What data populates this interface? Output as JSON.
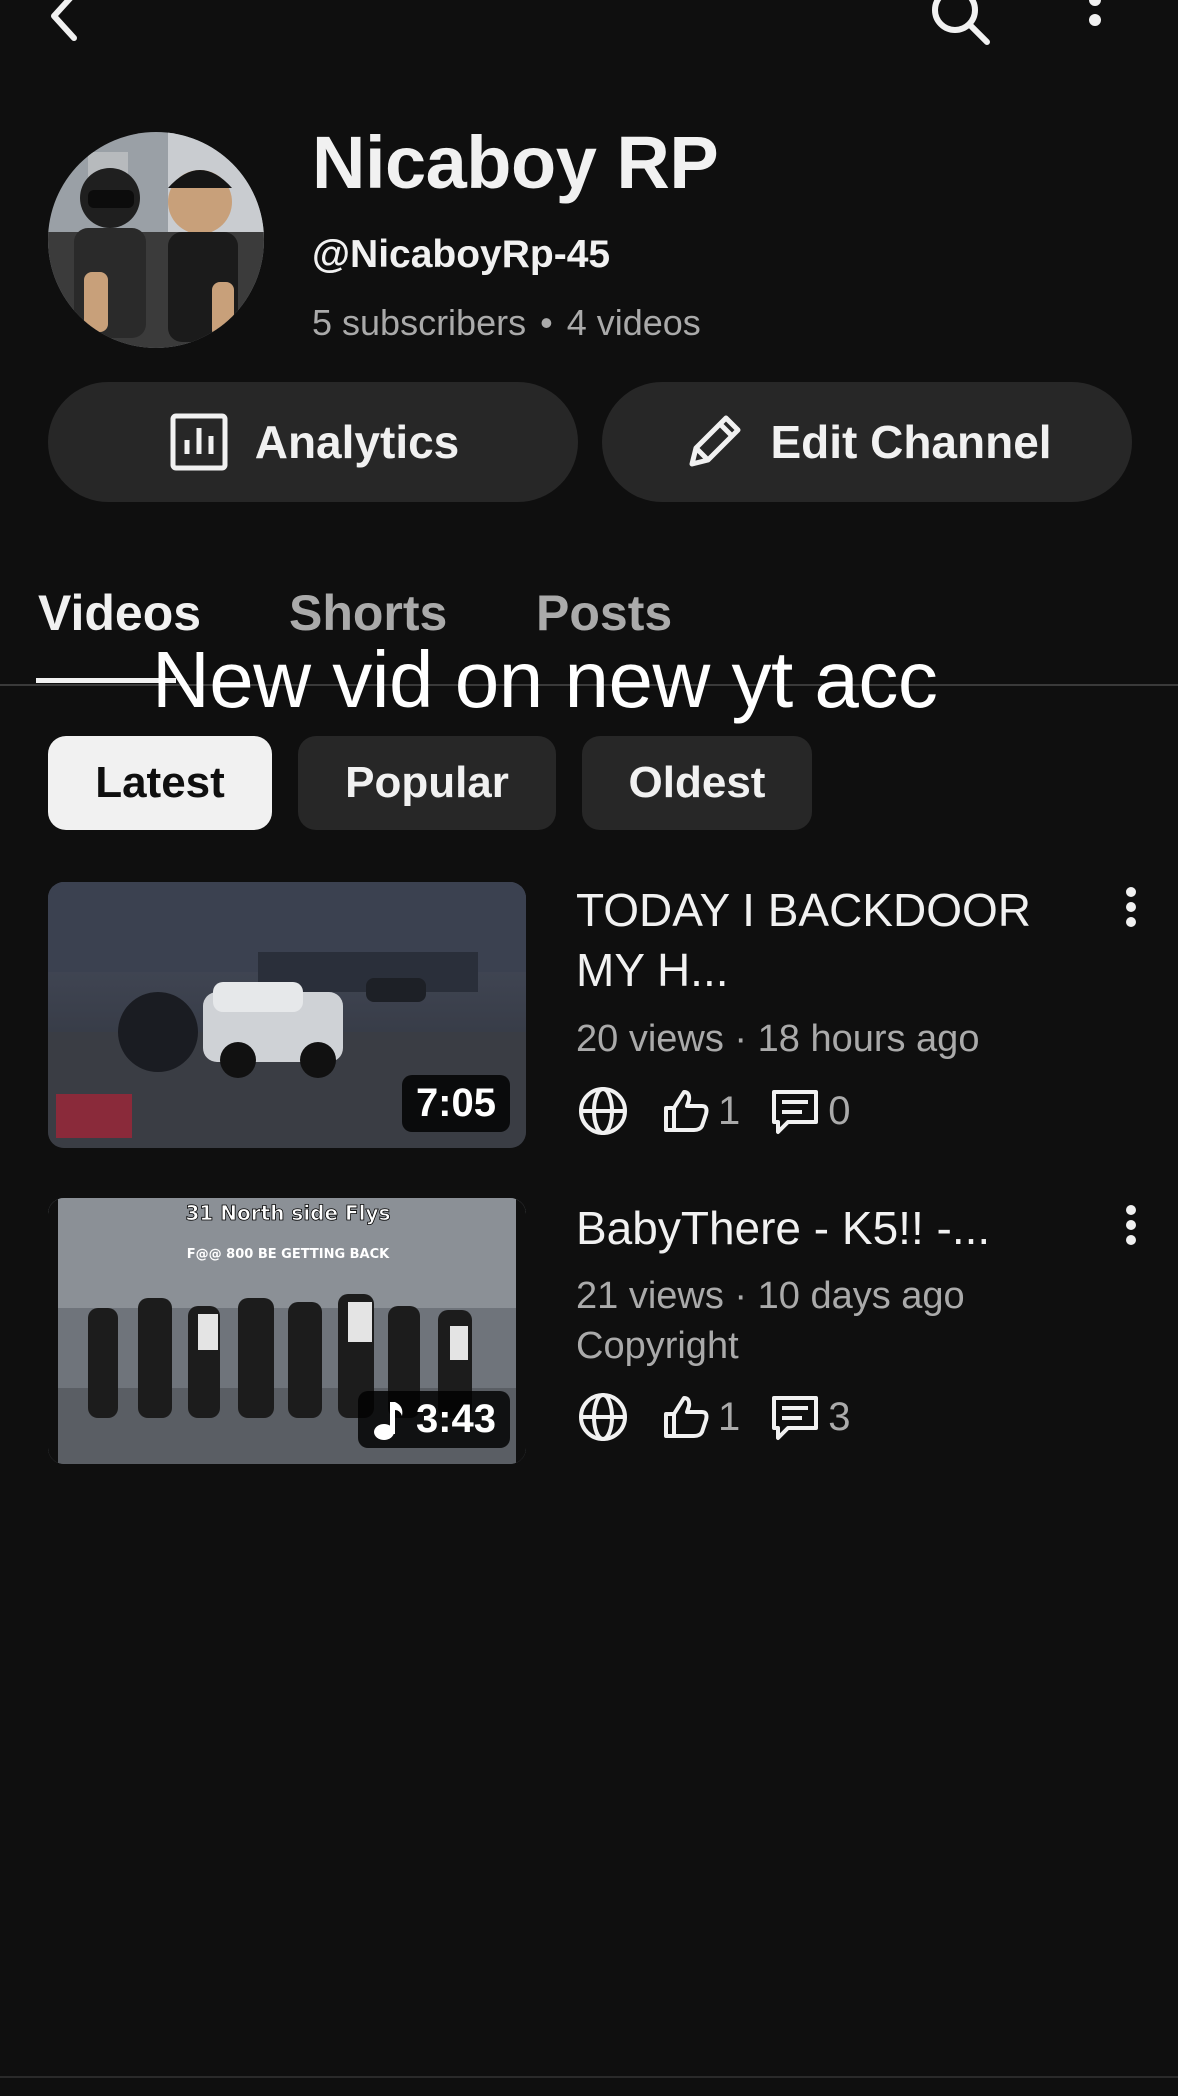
{
  "header": {
    "back_icon": "chevron-left-icon",
    "search_icon": "search-icon",
    "more_icon": "more-vert-icon"
  },
  "channel": {
    "name": "Nicaboy RP",
    "handle": "@NicaboyRp-45",
    "subscribers": "5 subscribers",
    "separator": "•",
    "video_count": "4 videos"
  },
  "actions": {
    "analytics_label": "Analytics",
    "edit_label": "Edit Channel"
  },
  "tabs": [
    {
      "label": "Videos",
      "selected": true
    },
    {
      "label": "Shorts",
      "selected": false
    },
    {
      "label": "Posts",
      "selected": false
    }
  ],
  "overlay_caption": "New vid on new yt acc",
  "filters": [
    {
      "label": "Latest",
      "selected": true
    },
    {
      "label": "Popular",
      "selected": false
    },
    {
      "label": "Oldest",
      "selected": false
    }
  ],
  "videos": [
    {
      "title": "TODAY I BACKDOOR MY H...",
      "meta": "20 views · 18 hours ago",
      "duration": "7:05",
      "likes": "1",
      "comments": "0",
      "copyright": ""
    },
    {
      "title": "BabyThere - K5!! -...",
      "meta": "21 views · 10 days ago",
      "duration": "3:43",
      "likes": "1",
      "comments": "3",
      "copyright": "Copyright",
      "thumb_text": {
        "line1": "31 North side Flys",
        "line2": "F@@ 800 BE GETTING BACK"
      }
    }
  ],
  "colors": {
    "background": "#0f0f0f",
    "surface": "#272727",
    "text_primary": "#f1f1f1",
    "text_secondary": "#aaaaaa"
  }
}
